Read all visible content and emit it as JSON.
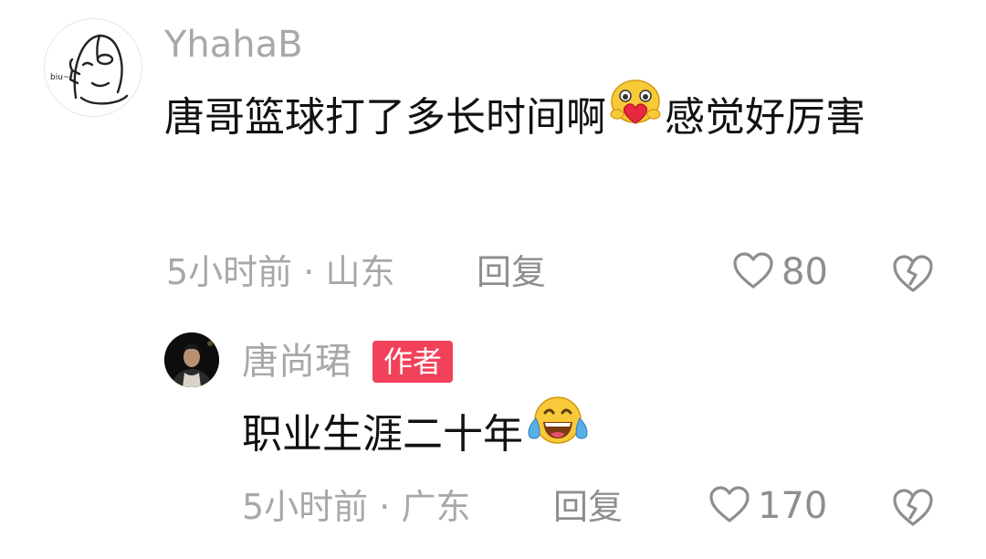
{
  "comment": {
    "username": "YhahaB",
    "text_before": "唐哥篮球打了多长时间啊",
    "emoji": "heart-hug-emoji",
    "text_after": "感觉好厉害",
    "time": "5小时前",
    "location": "山东",
    "separator": "·",
    "reply_label": "回复",
    "likes": "80"
  },
  "reply": {
    "username": "唐尚珺",
    "badge": "作者",
    "text": "职业生涯二十年",
    "emoji": "tears-of-joy-emoji",
    "time": "5小时前",
    "location": "广东",
    "separator": "·",
    "reply_label": "回复",
    "likes": "170"
  },
  "avatar_doodle_text": "biu~",
  "colors": {
    "text_primary": "#111111",
    "text_secondary": "#a8a8a8",
    "badge_bg": "#f2425a",
    "icon_gray": "#8e8e8e"
  }
}
